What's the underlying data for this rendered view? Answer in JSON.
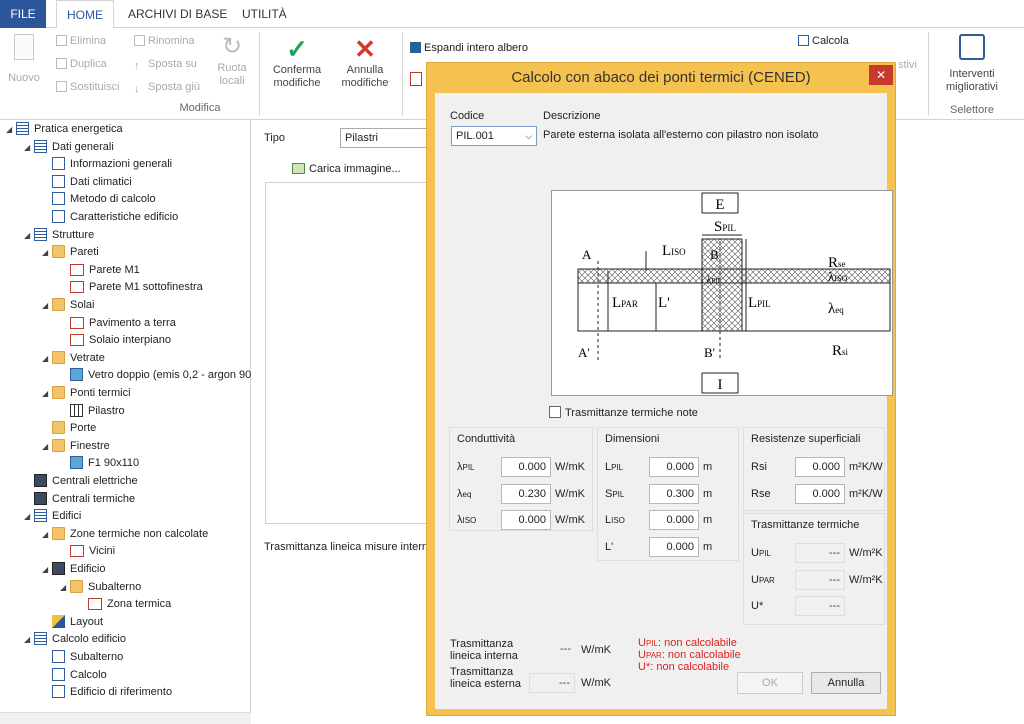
{
  "ribbon": {
    "tabs": [
      "FILE",
      "HOME",
      "ARCHIVI DI BASE",
      "UTILITÀ"
    ],
    "nuovo": "Nuovo",
    "elimina": "Elimina",
    "duplica": "Duplica",
    "sostituisci": "Sostituisci",
    "rinomina": "Rinomina",
    "sposta_su": "Sposta su",
    "sposta_giu": "Sposta giù",
    "ruota": [
      "Ruota",
      "locali"
    ],
    "modifica_group": "Modifica",
    "conferma": [
      "Conferma",
      "modifiche"
    ],
    "annulla": [
      "Annulla",
      "modifiche"
    ],
    "espandi": "Espandi intero albero",
    "calcola": "Calcola",
    "migliorativi_trunc": "stivi",
    "interventi": [
      "Interventi",
      "migliorativi"
    ],
    "selettore_group": "Selettore",
    "colors": {
      "file_tab": "#2b579a",
      "confirm": "#1fa35c",
      "cancel": "#d43a2a"
    }
  },
  "tree": [
    {
      "label": "Pratica energetica",
      "level": 0,
      "icon": "list-icon",
      "arrow": true
    },
    {
      "label": "Dati generali",
      "level": 1,
      "icon": "list-icon",
      "arrow": true
    },
    {
      "label": "Informazioni generali",
      "level": 2,
      "icon": "doc-icon"
    },
    {
      "label": "Dati climatici",
      "level": 2,
      "icon": "doc-icon"
    },
    {
      "label": "Metodo di calcolo",
      "level": 2,
      "icon": "doc-icon"
    },
    {
      "label": "Caratteristiche edificio",
      "level": 2,
      "icon": "doc-icon"
    },
    {
      "label": "Strutture",
      "level": 1,
      "icon": "list-icon",
      "arrow": true
    },
    {
      "label": "Pareti",
      "level": 2,
      "icon": "folder-icon",
      "arrow": true
    },
    {
      "label": "Parete M1",
      "level": 3,
      "icon": "house-icon"
    },
    {
      "label": "Parete M1 sottofinestra",
      "level": 3,
      "icon": "house-icon"
    },
    {
      "label": "Solai",
      "level": 2,
      "icon": "folder-icon",
      "arrow": true
    },
    {
      "label": "Pavimento a terra",
      "level": 3,
      "icon": "house-icon"
    },
    {
      "label": "Solaio interpiano",
      "level": 3,
      "icon": "house-icon"
    },
    {
      "label": "Vetrate",
      "level": 2,
      "icon": "folder-icon",
      "arrow": true
    },
    {
      "label": "Vetro doppio (emis 0,2 - argon 90",
      "level": 3,
      "icon": "glass-icon"
    },
    {
      "label": "Ponti termici",
      "level": 2,
      "icon": "folder-icon",
      "arrow": true
    },
    {
      "label": "Pilastro",
      "level": 3,
      "icon": "pillar-icon"
    },
    {
      "label": "Porte",
      "level": 2,
      "icon": "folder-icon"
    },
    {
      "label": "Finestre",
      "level": 2,
      "icon": "folder-icon",
      "arrow": true
    },
    {
      "label": "F1 90x110",
      "level": 3,
      "icon": "window-icon"
    },
    {
      "label": "Centrali elettriche",
      "level": 1,
      "icon": "building-icon"
    },
    {
      "label": "Centrali termiche",
      "level": 1,
      "icon": "building-icon"
    },
    {
      "label": "Edifici",
      "level": 1,
      "icon": "list-icon",
      "arrow": true
    },
    {
      "label": "Zone termiche non calcolate",
      "level": 2,
      "icon": "folder-icon",
      "arrow": true
    },
    {
      "label": "Vicini",
      "level": 3,
      "icon": "house-icon"
    },
    {
      "label": "Edificio",
      "level": 2,
      "icon": "building-icon",
      "arrow": true
    },
    {
      "label": "Subalterno",
      "level": 3,
      "icon": "folder-icon",
      "arrow": true
    },
    {
      "label": "Zona termica",
      "level": 4,
      "icon": "house-icon"
    },
    {
      "label": "Layout",
      "level": 2,
      "icon": "pencil-icon"
    },
    {
      "label": "Calcolo edificio",
      "level": 1,
      "icon": "list-icon",
      "arrow": true
    },
    {
      "label": "Subalterno",
      "level": 2,
      "icon": "doc-icon"
    },
    {
      "label": "Calcolo",
      "level": 2,
      "icon": "doc-icon"
    },
    {
      "label": "Edificio di riferimento",
      "level": 2,
      "icon": "doc-icon"
    }
  ],
  "mid": {
    "tipo_label": "Tipo",
    "tipo_value": "Pilastri",
    "carica": "Carica immagine...",
    "trasm_label": "Trasmittanza lineica misure interne"
  },
  "dialog": {
    "title": "Calcolo con abaco dei ponti termici (CENED)",
    "codice_label": "Codice",
    "codice_value": "PIL.001",
    "descr_label": "Descrizione",
    "descr_value": "Parete esterna isolata all'esterno con pilastro non isolato",
    "diagram": {
      "E": "E",
      "I": "I",
      "A": "A",
      "A2": "A'",
      "B": "B",
      "B2": "B'",
      "S": "S",
      "S_sub": "PIL",
      "L": "L",
      "L_sub": "ISO",
      "LPAR": "L",
      "LPAR_sub": "PAR",
      "Lp": "L'",
      "LPIL": "L",
      "LPIL_sub": "PIL",
      "Rse": "R",
      "Rse_sub": "se",
      "liso": "λ",
      "liso_sub": "ISO",
      "leq": "λ",
      "leq_sub": "eq",
      "lpil": "λ",
      "lpil_sub": "PIL",
      "Rsi": "R",
      "Rsi_sub": "si"
    },
    "note_check": "Trasmittanze termiche note",
    "cond_header": "Conduttività",
    "cond": [
      {
        "sym": "λ",
        "sub": "PIL",
        "value": "0.000",
        "unit": "W/mK"
      },
      {
        "sym": "λ",
        "sub": "eq",
        "value": "0.230",
        "unit": "W/mK"
      },
      {
        "sym": "λ",
        "sub": "ISO",
        "value": "0.000",
        "unit": "W/mK"
      }
    ],
    "dim_header": "Dimensioni",
    "dim": [
      {
        "sym": "L",
        "sub": "PIL",
        "value": "0.000",
        "unit": "m"
      },
      {
        "sym": "S",
        "sub": "PIL",
        "value": "0.300",
        "unit": "m"
      },
      {
        "sym": "L",
        "sub": "ISO",
        "value": "0.000",
        "unit": "m"
      },
      {
        "sym": "L'",
        "sub": "",
        "value": "0.000",
        "unit": "m"
      }
    ],
    "res_header": "Resistenze superficiali",
    "res": [
      {
        "sym": "Rsi",
        "value": "0.000",
        "unit": "m²K/W"
      },
      {
        "sym": "Rse",
        "value": "0.000",
        "unit": "m²K/W"
      }
    ],
    "trasm_header": "Trasmittanze termiche",
    "trasm": [
      {
        "sym": "U",
        "sub": "PIL",
        "value": "---",
        "unit": "W/m²K"
      },
      {
        "sym": "U",
        "sub": "PAR",
        "value": "---",
        "unit": "W/m²K"
      },
      {
        "sym": "U*",
        "sub": "",
        "value": "---",
        "unit": ""
      }
    ],
    "lin_int": [
      "Trasmittanza",
      "lineica interna"
    ],
    "lin_int_value": "---",
    "lin_int_unit": "W/mK",
    "lin_ext": [
      "Trasmittanza",
      "lineica esterna"
    ],
    "lin_ext_value": "---",
    "lin_ext_unit": "W/mK",
    "errors": [
      {
        "sym": "U",
        "sub": "PIL",
        "text": ": non calcolabile"
      },
      {
        "sym": "U",
        "sub": "PAR",
        "text": ": non calcolabile"
      },
      {
        "sym": "U*",
        "sub": "",
        "text": ": non calcolabile"
      }
    ],
    "ok": "OK",
    "cancel": "Annulla"
  }
}
